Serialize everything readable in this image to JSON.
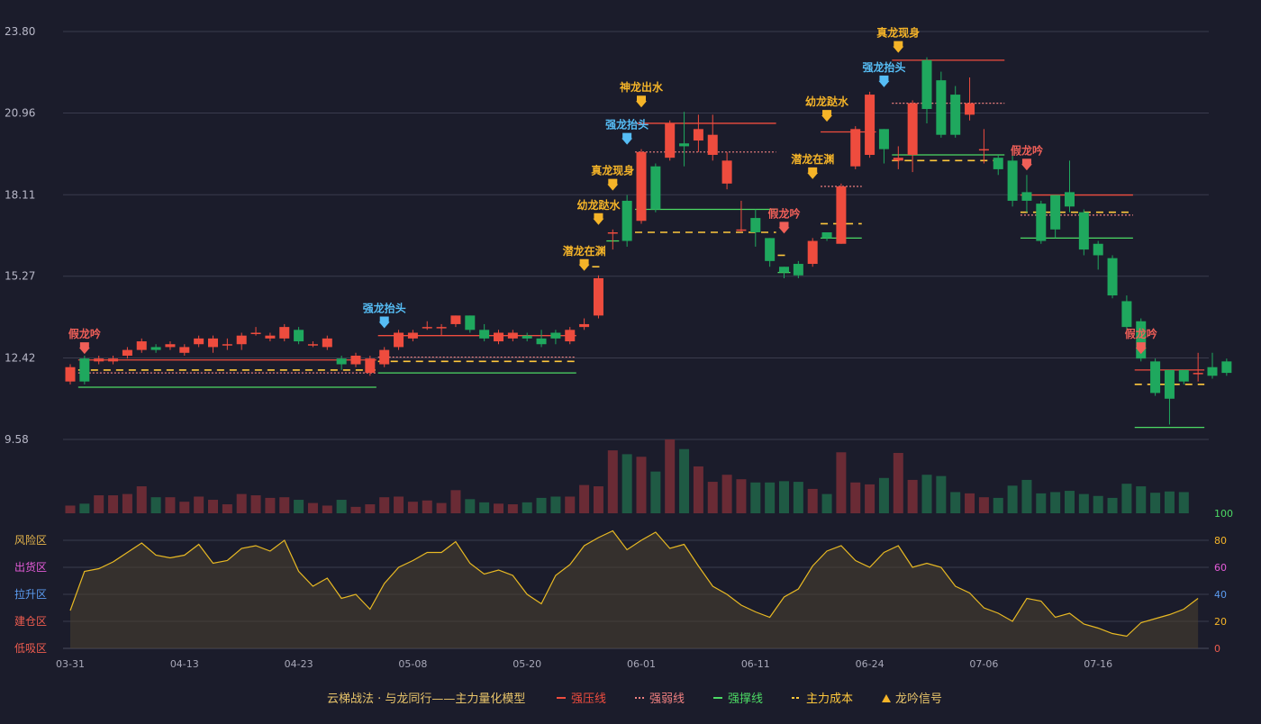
{
  "chart_data": {
    "type": "candlestick",
    "price_axis": {
      "ticks": [
        "23.80",
        "20.96",
        "18.11",
        "15.27",
        "12.42",
        "9.58"
      ],
      "min": 9.58,
      "max": 23.8
    },
    "x_tick_labels": [
      {
        "i": 0,
        "label": "03-31"
      },
      {
        "i": 8,
        "label": "04-13"
      },
      {
        "i": 16,
        "label": "04-23"
      },
      {
        "i": 24,
        "label": "05-08"
      },
      {
        "i": 32,
        "label": "05-20"
      },
      {
        "i": 40,
        "label": "06-01"
      },
      {
        "i": 48,
        "label": "06-11"
      },
      {
        "i": 56,
        "label": "06-24"
      },
      {
        "i": 64,
        "label": "07-06"
      },
      {
        "i": 72,
        "label": "07-16"
      }
    ],
    "candles": [
      [
        11.6,
        12.1,
        11.5,
        12.2
      ],
      [
        12.4,
        11.6,
        11.5,
        12.5
      ],
      [
        12.3,
        12.4,
        12.2,
        12.5
      ],
      [
        12.3,
        12.4,
        12.2,
        12.5
      ],
      [
        12.5,
        12.7,
        12.4,
        12.8
      ],
      [
        12.7,
        13.0,
        12.6,
        13.1
      ],
      [
        12.8,
        12.7,
        12.6,
        12.9
      ],
      [
        12.8,
        12.9,
        12.7,
        13.0
      ],
      [
        12.6,
        12.8,
        12.5,
        12.9
      ],
      [
        12.9,
        13.1,
        12.8,
        13.2
      ],
      [
        12.8,
        13.1,
        12.6,
        13.2
      ],
      [
        12.9,
        12.9,
        12.7,
        13.1
      ],
      [
        12.9,
        13.2,
        12.7,
        13.3
      ],
      [
        13.3,
        13.3,
        13.2,
        13.5
      ],
      [
        13.1,
        13.2,
        13.0,
        13.3
      ],
      [
        13.1,
        13.5,
        13.0,
        13.6
      ],
      [
        13.4,
        13.0,
        12.9,
        13.5
      ],
      [
        12.9,
        12.9,
        12.8,
        13.0
      ],
      [
        12.8,
        13.1,
        12.7,
        13.2
      ],
      [
        12.4,
        12.2,
        12.0,
        12.5
      ],
      [
        12.2,
        12.5,
        12.1,
        12.6
      ],
      [
        11.9,
        12.4,
        11.8,
        12.5
      ],
      [
        12.2,
        12.7,
        12.1,
        12.8
      ],
      [
        12.8,
        13.3,
        12.7,
        13.4
      ],
      [
        13.1,
        13.3,
        13.0,
        13.4
      ],
      [
        13.5,
        13.5,
        13.4,
        13.7
      ],
      [
        13.5,
        13.5,
        13.2,
        13.6
      ],
      [
        13.6,
        13.9,
        13.5,
        13.9
      ],
      [
        13.9,
        13.4,
        13.3,
        13.9
      ],
      [
        13.4,
        13.1,
        13.0,
        13.6
      ],
      [
        13.0,
        13.3,
        12.9,
        13.4
      ],
      [
        13.1,
        13.3,
        13.0,
        13.4
      ],
      [
        13.2,
        13.1,
        13.0,
        13.3
      ],
      [
        13.1,
        12.9,
        12.8,
        13.4
      ],
      [
        13.3,
        13.1,
        12.9,
        13.4
      ],
      [
        13.0,
        13.4,
        12.9,
        13.5
      ],
      [
        13.5,
        13.6,
        13.4,
        13.8
      ],
      [
        13.9,
        15.2,
        13.8,
        15.3
      ],
      [
        16.8,
        16.8,
        16.2,
        16.9
      ],
      [
        17.9,
        16.5,
        16.3,
        18.1
      ],
      [
        17.2,
        19.6,
        17.1,
        19.7
      ],
      [
        19.1,
        17.6,
        17.5,
        19.2
      ],
      [
        19.4,
        20.6,
        19.3,
        20.7
      ],
      [
        19.9,
        19.8,
        19.1,
        21.0
      ],
      [
        20.0,
        20.4,
        19.6,
        20.9
      ],
      [
        19.5,
        20.2,
        19.3,
        20.9
      ],
      [
        18.5,
        19.3,
        18.3,
        19.6
      ],
      [
        16.9,
        16.9,
        16.8,
        17.9
      ],
      [
        17.3,
        16.8,
        16.3,
        17.6
      ],
      [
        16.6,
        15.8,
        15.6,
        16.6
      ],
      [
        15.6,
        15.4,
        15.2,
        15.6
      ],
      [
        15.7,
        15.3,
        15.2,
        15.8
      ],
      [
        15.7,
        16.5,
        15.6,
        16.6
      ],
      [
        16.8,
        16.6,
        16.5,
        16.8
      ],
      [
        16.4,
        18.4,
        16.4,
        18.5
      ],
      [
        19.1,
        20.4,
        19.0,
        20.5
      ],
      [
        19.5,
        21.6,
        19.4,
        21.7
      ],
      [
        20.4,
        19.7,
        19.2,
        20.4
      ],
      [
        19.3,
        19.4,
        19.0,
        19.8
      ],
      [
        19.5,
        21.3,
        18.9,
        21.4
      ],
      [
        22.8,
        21.1,
        20.6,
        22.9
      ],
      [
        22.1,
        20.2,
        20.1,
        22.4
      ],
      [
        21.6,
        20.2,
        20.1,
        21.9
      ],
      [
        20.9,
        21.3,
        20.7,
        22.2
      ],
      [
        19.7,
        19.7,
        19.2,
        20.4
      ],
      [
        19.4,
        19.0,
        18.8,
        19.5
      ],
      [
        19.3,
        17.9,
        17.7,
        19.6
      ],
      [
        18.2,
        17.9,
        17.5,
        18.8
      ],
      [
        17.8,
        16.5,
        16.4,
        17.9
      ],
      [
        18.1,
        16.9,
        16.6,
        18.1
      ],
      [
        18.2,
        17.7,
        17.5,
        19.3
      ],
      [
        17.5,
        16.2,
        16.0,
        17.6
      ],
      [
        16.4,
        16.0,
        15.5,
        16.5
      ],
      [
        15.9,
        14.6,
        14.5,
        16.0
      ],
      [
        14.4,
        13.5,
        13.4,
        14.6
      ],
      [
        13.7,
        12.4,
        12.3,
        13.8
      ],
      [
        12.3,
        11.2,
        11.1,
        12.4
      ],
      [
        12.0,
        11.0,
        10.1,
        12.0
      ],
      [
        12.0,
        11.6,
        11.5,
        12.0
      ],
      [
        11.9,
        11.9,
        11.6,
        12.6
      ],
      [
        12.1,
        11.8,
        11.7,
        12.6
      ],
      [
        12.3,
        11.9,
        11.8,
        12.4
      ]
    ],
    "volume": [
      12,
      15,
      28,
      28,
      30,
      42,
      25,
      25,
      18,
      26,
      21,
      14,
      30,
      28,
      24,
      25,
      21,
      16,
      12,
      21,
      10,
      14,
      25,
      26,
      18,
      20,
      16,
      36,
      22,
      17,
      15,
      14,
      17,
      24,
      26,
      26,
      44,
      42,
      98,
      92,
      88,
      65,
      115,
      100,
      73,
      49,
      60,
      53,
      48,
      48,
      50,
      49,
      38,
      30,
      95,
      48,
      45,
      55,
      94,
      52,
      60,
      58,
      33,
      31,
      25,
      24,
      43,
      52,
      31,
      33,
      35,
      30,
      27,
      24,
      46,
      42,
      32,
      34,
      33
    ],
    "markers": [
      {
        "i": 1,
        "text": "假龙吟",
        "kind": "fake",
        "price": 12.4
      },
      {
        "i": 22,
        "text": "强龙抬头",
        "kind": "strong",
        "price": 13.3
      },
      {
        "i": 36,
        "text": "潜龙在渊",
        "kind": "gold",
        "price": 15.3
      },
      {
        "i": 37,
        "text": "幼龙跶水",
        "kind": "gold",
        "price": 16.9
      },
      {
        "i": 38,
        "text": "真龙现身",
        "kind": "gold",
        "price": 18.1
      },
      {
        "i": 39,
        "text": "强龙抬头",
        "kind": "strong",
        "price": 19.7
      },
      {
        "i": 40,
        "text": "神龙出水",
        "kind": "gold",
        "price": 21.0
      },
      {
        "i": 50,
        "text": "假龙吟",
        "kind": "fake",
        "price": 16.6
      },
      {
        "i": 52,
        "text": "潜龙在渊",
        "kind": "gold",
        "price": 18.5
      },
      {
        "i": 53,
        "text": "幼龙跶水",
        "kind": "gold",
        "price": 20.5
      },
      {
        "i": 57,
        "text": "强龙抬头",
        "kind": "strong",
        "price": 21.7
      },
      {
        "i": 58,
        "text": "真龙现身",
        "kind": "gold",
        "price": 22.9
      },
      {
        "i": 67,
        "text": "假龙吟",
        "kind": "fake",
        "price": 18.8
      },
      {
        "i": 75,
        "text": "假龙吟",
        "kind": "fake",
        "price": 12.4
      }
    ],
    "levels": [
      {
        "kind": "pressure",
        "from": 1,
        "to": 21,
        "price": 12.35
      },
      {
        "kind": "weak",
        "from": 1,
        "to": 21,
        "price": 11.9
      },
      {
        "kind": "cost",
        "from": 1,
        "to": 21,
        "price": 12.0
      },
      {
        "kind": "support",
        "from": 1,
        "to": 21,
        "price": 11.4
      },
      {
        "kind": "pressure",
        "from": 22,
        "to": 35,
        "price": 13.2
      },
      {
        "kind": "weak",
        "from": 22,
        "to": 35,
        "price": 12.45
      },
      {
        "kind": "cost",
        "from": 22,
        "to": 35,
        "price": 12.3
      },
      {
        "kind": "support",
        "from": 22,
        "to": 35,
        "price": 11.9
      },
      {
        "kind": "cost",
        "from": 37,
        "to": 37,
        "price": 15.6
      },
      {
        "kind": "support",
        "from": 38,
        "to": 38,
        "price": 16.5
      },
      {
        "kind": "pressure",
        "from": 40,
        "to": 49,
        "price": 20.6
      },
      {
        "kind": "weak",
        "from": 40,
        "to": 49,
        "price": 19.6
      },
      {
        "kind": "support",
        "from": 40,
        "to": 49,
        "price": 17.6
      },
      {
        "kind": "cost",
        "from": 40,
        "to": 49,
        "price": 16.8
      },
      {
        "kind": "support",
        "from": 50,
        "to": 50,
        "price": 15.4
      },
      {
        "kind": "cost",
        "from": 50,
        "to": 50,
        "price": 16.0
      },
      {
        "kind": "weak",
        "from": 53,
        "to": 55,
        "price": 18.4
      },
      {
        "kind": "cost",
        "from": 53,
        "to": 55,
        "price": 17.1
      },
      {
        "kind": "support",
        "from": 53,
        "to": 55,
        "price": 16.6
      },
      {
        "kind": "pressure",
        "from": 53,
        "to": 56,
        "price": 20.3
      },
      {
        "kind": "pressure",
        "from": 58,
        "to": 65,
        "price": 22.8
      },
      {
        "kind": "weak",
        "from": 58,
        "to": 65,
        "price": 21.3
      },
      {
        "kind": "support",
        "from": 58,
        "to": 65,
        "price": 19.5
      },
      {
        "kind": "cost",
        "from": 58,
        "to": 65,
        "price": 19.3
      },
      {
        "kind": "pressure",
        "from": 67,
        "to": 74,
        "price": 18.1
      },
      {
        "kind": "cost",
        "from": 67,
        "to": 74,
        "price": 17.5
      },
      {
        "kind": "weak",
        "from": 67,
        "to": 74,
        "price": 17.4
      },
      {
        "kind": "support",
        "from": 67,
        "to": 74,
        "price": 16.6
      },
      {
        "kind": "pressure",
        "from": 75,
        "to": 79,
        "price": 12.0
      },
      {
        "kind": "cost",
        "from": 75,
        "to": 79,
        "price": 11.5
      },
      {
        "kind": "support",
        "from": 75,
        "to": 79,
        "price": 10.0
      }
    ],
    "indicator": {
      "min": 0,
      "max": 100,
      "right_ticks": [
        "100",
        "80",
        "60",
        "40",
        "20",
        "0"
      ],
      "zones": [
        {
          "label": "风险区",
          "value": 80,
          "color": "#e7b64b"
        },
        {
          "label": "出货区",
          "value": 60,
          "color": "#e45bd8"
        },
        {
          "label": "拉升区",
          "value": 40,
          "color": "#5b9bf0"
        },
        {
          "label": "建仓区",
          "value": 20,
          "color": "#ee5c4f"
        },
        {
          "label": "低吸区",
          "value": 0,
          "color": "#ee5c4f"
        }
      ],
      "values": [
        28,
        57,
        59,
        64,
        71,
        78,
        69,
        67,
        69,
        77,
        63,
        65,
        74,
        76,
        72,
        80,
        57,
        46,
        52,
        37,
        40,
        29,
        48,
        60,
        65,
        71,
        71,
        79,
        63,
        55,
        58,
        54,
        40,
        33,
        54,
        62,
        76,
        82,
        87,
        73,
        80,
        86,
        74,
        77,
        61,
        46,
        40,
        32,
        27,
        23,
        38,
        44,
        61,
        72,
        76,
        65,
        60,
        71,
        76,
        60,
        63,
        60,
        46,
        41,
        30,
        26,
        20,
        37,
        35,
        23,
        26,
        18,
        15,
        11,
        9,
        19,
        22,
        25,
        29,
        37
      ]
    },
    "colors": {
      "up": "#ee4c3e",
      "down": "#1fa85e",
      "vol_up": "#6a2b35",
      "vol_down": "#1f5a44",
      "line": "#e8b923",
      "gold": "#f5b428",
      "strong": "#56bdf5",
      "fake": "#ef5f58",
      "pressure": "#ef4c3e",
      "weak": "#f08080",
      "support": "#4cd964",
      "cost": "#ffc83c"
    },
    "legend": [
      {
        "kind": "title",
        "text": "云梯战法 · 与龙同行——主力量化模型"
      },
      {
        "kind": "pressure",
        "text": "强压线"
      },
      {
        "kind": "weak",
        "text": "强弱线"
      },
      {
        "kind": "support",
        "text": "强撑线"
      },
      {
        "kind": "cost",
        "text": "主力成本"
      },
      {
        "kind": "signal",
        "text": "龙吟信号"
      }
    ]
  }
}
